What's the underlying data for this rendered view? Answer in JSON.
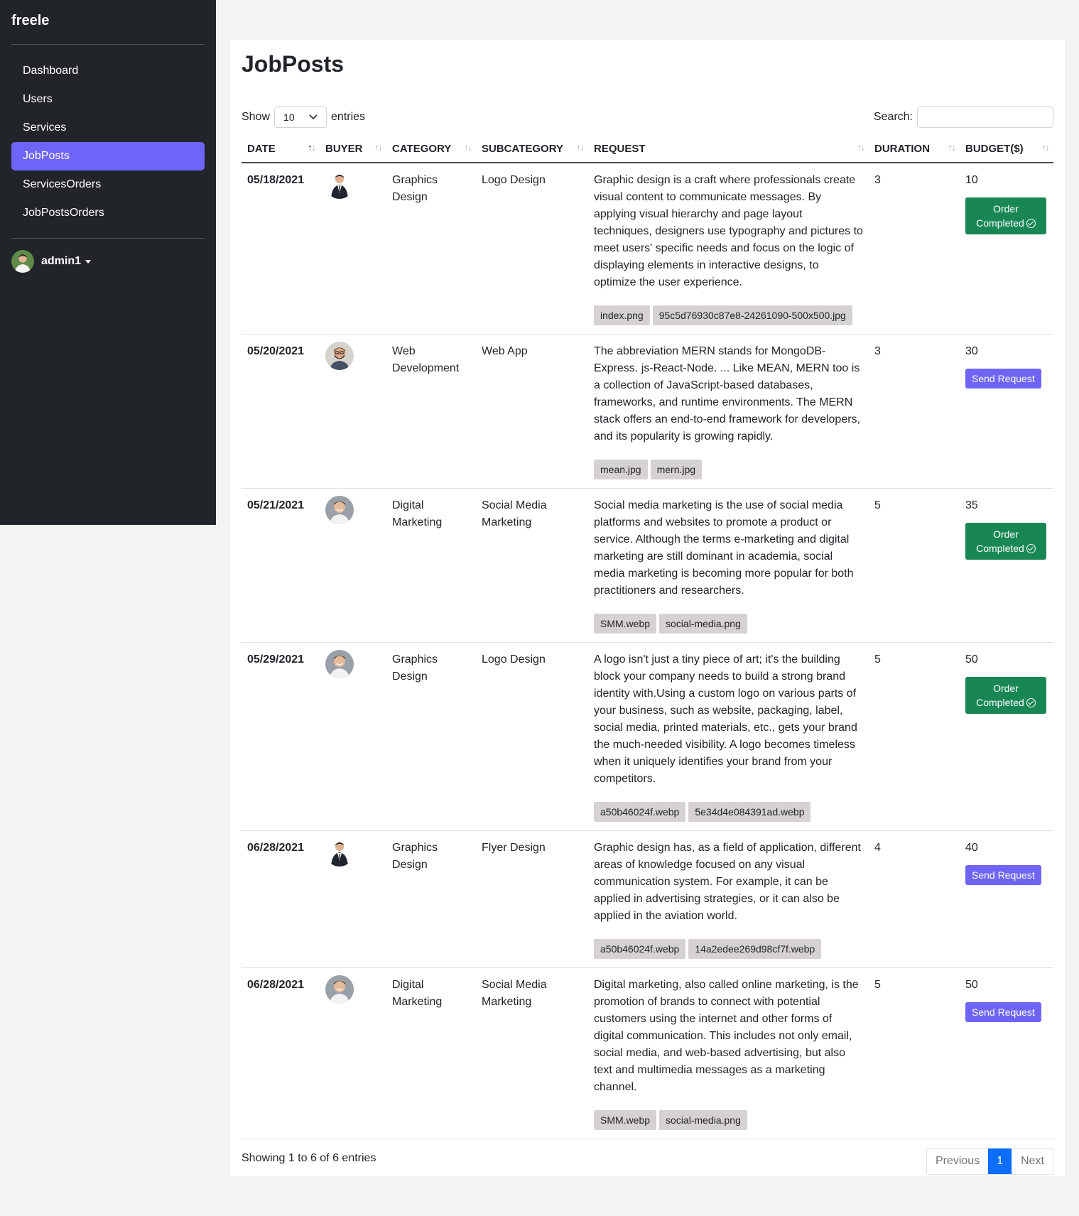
{
  "sidebar": {
    "brand": "freele",
    "items": [
      {
        "label": "Dashboard",
        "active": false
      },
      {
        "label": "Users",
        "active": false
      },
      {
        "label": "Services",
        "active": false
      },
      {
        "label": "JobPosts",
        "active": true
      },
      {
        "label": "ServicesOrders",
        "active": false
      },
      {
        "label": "JobPostsOrders",
        "active": false
      }
    ],
    "user": {
      "name": "admin1",
      "icon": "avatar"
    }
  },
  "page": {
    "title": "JobPosts"
  },
  "length": {
    "show_label": "Show",
    "value": "10",
    "entries_label": "entries"
  },
  "search": {
    "label": "Search:",
    "value": ""
  },
  "table": {
    "columns": [
      "DATE",
      "BUYER",
      "CATEGORY",
      "SUBCATEGORY",
      "REQUEST",
      "DURATION",
      "BUDGET($)"
    ],
    "sorted_column": "DATE",
    "rows": [
      {
        "date": "05/18/2021",
        "buyer_avatar": "avatar-man-suit",
        "category": "Graphics Design",
        "subcategory": "Logo Design",
        "request": "Graphic design is a craft where professionals create visual content to communicate messages. By applying visual hierarchy and page layout techniques, designers use typography and pictures to meet users' specific needs and focus on the logic of displaying elements in interactive designs, to optimize the user experience.",
        "files": [
          "index.png",
          "95c5d76930c87e8-24261090-500x500.jpg"
        ],
        "duration": "3",
        "budget": "10",
        "action": {
          "type": "completed",
          "label1": "Order",
          "label2": "Completed"
        }
      },
      {
        "date": "05/20/2021",
        "buyer_avatar": "avatar-man-beard",
        "category": "Web Development",
        "subcategory": "Web App",
        "request": "The abbreviation MERN stands for MongoDB-Express. js-React-Node. ... Like MEAN, MERN too is a collection of JavaScript-based databases, frameworks, and runtime environments. The MERN stack offers an end-to-end framework for developers, and its popularity is growing rapidly.",
        "files": [
          "mean.jpg",
          "mern.jpg"
        ],
        "duration": "3",
        "budget": "30",
        "action": {
          "type": "send",
          "label": "Send Request"
        }
      },
      {
        "date": "05/21/2021",
        "buyer_avatar": "avatar-man-smile",
        "category": "Digital Marketing",
        "subcategory": "Social Media Marketing",
        "request": "Social media marketing is the use of social media platforms and websites to promote a product or service. Although the terms e-marketing and digital marketing are still dominant in academia, social media marketing is becoming more popular for both practitioners and researchers.",
        "files": [
          "SMM.webp",
          "social-media.png"
        ],
        "duration": "5",
        "budget": "35",
        "action": {
          "type": "completed",
          "label1": "Order",
          "label2": "Completed"
        }
      },
      {
        "date": "05/29/2021",
        "buyer_avatar": "avatar-man-smile",
        "category": "Graphics Design",
        "subcategory": "Logo Design",
        "request": "A logo isn't just a tiny piece of art; it's the building block your company needs to build a strong brand identity with.Using a custom logo on various parts of your business, such as website, packaging, label, social media, printed materials, etc., gets your brand the much-needed visibility. A logo becomes timeless when it uniquely identifies your brand from your competitors.",
        "files": [
          "a50b46024f.webp",
          "5e34d4e084391ad.webp"
        ],
        "duration": "5",
        "budget": "50",
        "action": {
          "type": "completed",
          "label1": "Order",
          "label2": "Completed"
        }
      },
      {
        "date": "06/28/2021",
        "buyer_avatar": "avatar-man-suit",
        "category": "Graphics Design",
        "subcategory": "Flyer Design",
        "request": "Graphic design has, as a field of application, different areas of knowledge focused on any visual communication system. For example, it can be applied in advertising strategies, or it can also be applied in the aviation world.",
        "files": [
          "a50b46024f.webp",
          "14a2edee269d98cf7f.webp"
        ],
        "duration": "4",
        "budget": "40",
        "action": {
          "type": "send",
          "label": "Send Request"
        }
      },
      {
        "date": "06/28/2021",
        "buyer_avatar": "avatar-man-smile",
        "category": "Digital Marketing",
        "subcategory": "Social Media Marketing",
        "request": "Digital marketing, also called online marketing, is the promotion of brands to connect with potential customers using the internet and other forms of digital communication. This includes not only email, social media, and web-based advertising, but also text and multimedia messages as a marketing channel.",
        "files": [
          "SMM.webp",
          "social-media.png"
        ],
        "duration": "5",
        "budget": "50",
        "action": {
          "type": "send",
          "label": "Send Request"
        }
      }
    ]
  },
  "footer": {
    "info": "Showing 1 to 6 of 6 entries",
    "previous": "Previous",
    "current": "1",
    "next": "Next"
  },
  "colors": {
    "sidebar_bg": "#212529",
    "accent": "#6f64f8",
    "success": "#198754",
    "pager_active": "#0d6efd"
  }
}
